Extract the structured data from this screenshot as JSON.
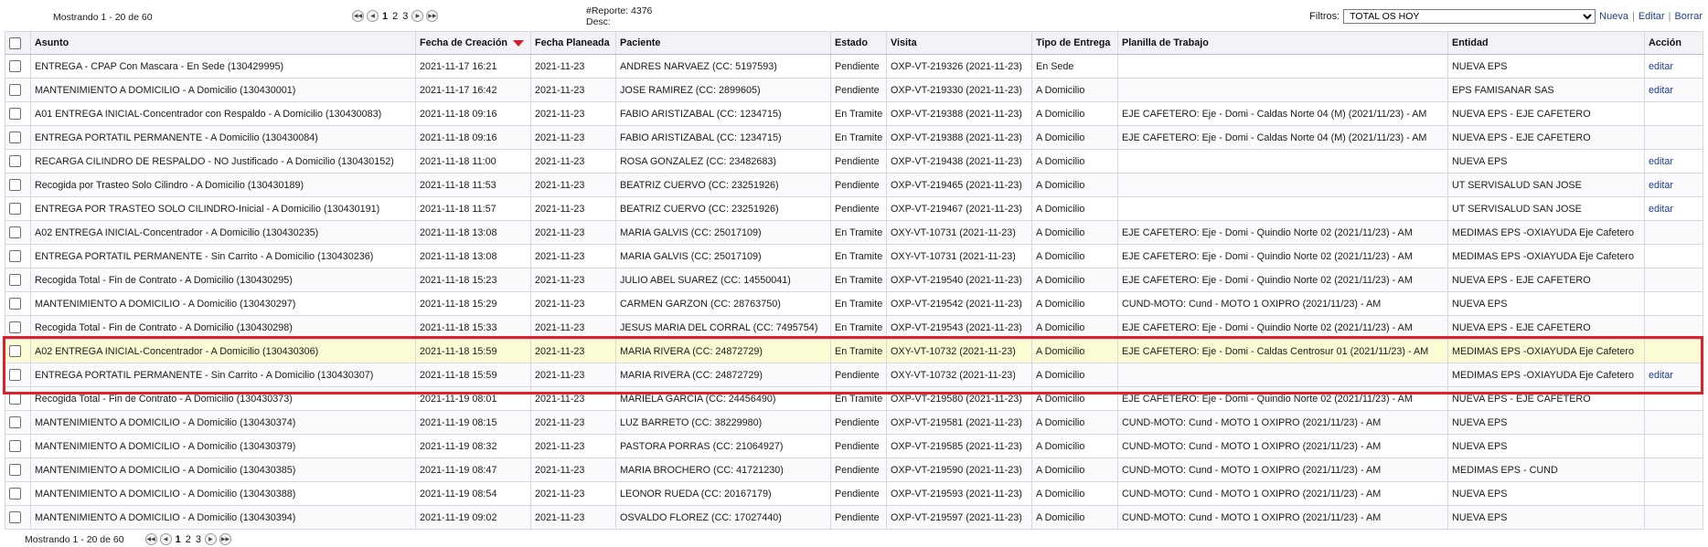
{
  "pagination": {
    "showing": "Mostrando 1 - 20 de 60",
    "pages": [
      "1",
      "2",
      "3"
    ],
    "current": "1"
  },
  "report": {
    "number": "#Reporte: 4376",
    "desc": "Desc:"
  },
  "filters": {
    "label": "Filtros:",
    "selected": "TOTAL OS HOY",
    "nueva": "Nueva",
    "editar": "Editar",
    "borrar": "Borrar"
  },
  "columns": [
    "Asunto",
    "Fecha de Creación",
    "Fecha Planeada",
    "Paciente",
    "Estado",
    "Visita",
    "Tipo de Entrega",
    "Planilla de Trabajo",
    "Entidad",
    "Acción"
  ],
  "rows": [
    {
      "asunto": "ENTREGA - CPAP Con Mascara - En Sede (130429995)",
      "creacion": "2021-11-17 16:21",
      "planeada": "2021-11-23",
      "paciente": "ANDRES NARVAEZ (CC: 5197593)",
      "estado": "Pendiente",
      "visita": "OXP-VT-219326 (2021-11-23)",
      "tipo": "En Sede",
      "planilla": "",
      "entidad": "NUEVA EPS",
      "accion": "editar"
    },
    {
      "asunto": "MANTENIMIENTO A DOMICILIO - A Domicilio (130430001)",
      "creacion": "2021-11-17 16:42",
      "planeada": "2021-11-23",
      "paciente": "JOSE RAMIREZ (CC: 2899605)",
      "estado": "Pendiente",
      "visita": "OXP-VT-219330 (2021-11-23)",
      "tipo": "A Domicilio",
      "planilla": "",
      "entidad": "EPS FAMISANAR SAS",
      "accion": "editar"
    },
    {
      "asunto": "A01 ENTREGA INICIAL-Concentrador con Respaldo - A Domicilio (130430083)",
      "creacion": "2021-11-18 09:16",
      "planeada": "2021-11-23",
      "paciente": "FABIO ARISTIZABAL (CC: 1234715)",
      "estado": "En Tramite",
      "visita": "OXP-VT-219388 (2021-11-23)",
      "tipo": "A Domicilio",
      "planilla": "EJE CAFETERO: Eje - Domi - Caldas Norte 04 (M) (2021/11/23) - AM",
      "entidad": "NUEVA EPS - EJE CAFETERO",
      "accion": ""
    },
    {
      "asunto": "ENTREGA PORTATIL PERMANENTE - A Domicilio (130430084)",
      "creacion": "2021-11-18 09:16",
      "planeada": "2021-11-23",
      "paciente": "FABIO ARISTIZABAL (CC: 1234715)",
      "estado": "En Tramite",
      "visita": "OXP-VT-219388 (2021-11-23)",
      "tipo": "A Domicilio",
      "planilla": "EJE CAFETERO: Eje - Domi - Caldas Norte 04 (M) (2021/11/23) - AM",
      "entidad": "NUEVA EPS - EJE CAFETERO",
      "accion": ""
    },
    {
      "asunto": "RECARGA CILINDRO DE RESPALDO - NO Justificado - A Domicilio (130430152)",
      "creacion": "2021-11-18 11:00",
      "planeada": "2021-11-23",
      "paciente": "ROSA GONZALEZ (CC: 23482683)",
      "estado": "Pendiente",
      "visita": "OXP-VT-219438 (2021-11-23)",
      "tipo": "A Domicilio",
      "planilla": "",
      "entidad": "NUEVA EPS",
      "accion": "editar"
    },
    {
      "asunto": "Recogida por Trasteo Solo Cilindro - A Domicilio (130430189)",
      "creacion": "2021-11-18 11:53",
      "planeada": "2021-11-23",
      "paciente": "BEATRIZ CUERVO (CC: 23251926)",
      "estado": "Pendiente",
      "visita": "OXP-VT-219465 (2021-11-23)",
      "tipo": "A Domicilio",
      "planilla": "",
      "entidad": "UT SERVISALUD SAN JOSE",
      "accion": "editar"
    },
    {
      "asunto": "ENTREGA POR TRASTEO SOLO CILINDRO-Inicial - A Domicilio (130430191)",
      "creacion": "2021-11-18 11:57",
      "planeada": "2021-11-23",
      "paciente": "BEATRIZ CUERVO (CC: 23251926)",
      "estado": "Pendiente",
      "visita": "OXP-VT-219467 (2021-11-23)",
      "tipo": "A Domicilio",
      "planilla": "",
      "entidad": "UT SERVISALUD SAN JOSE",
      "accion": "editar"
    },
    {
      "asunto": "A02 ENTREGA INICIAL-Concentrador - A Domicilio (130430235)",
      "creacion": "2021-11-18 13:08",
      "planeada": "2021-11-23",
      "paciente": "MARIA GALVIS (CC: 25017109)",
      "estado": "En Tramite",
      "visita": "OXY-VT-10731 (2021-11-23)",
      "tipo": "A Domicilio",
      "planilla": "EJE CAFETERO: Eje - Domi - Quindio Norte 02 (2021/11/23) - AM",
      "entidad": "MEDIMAS EPS -OXIAYUDA Eje Cafetero",
      "accion": ""
    },
    {
      "asunto": "ENTREGA PORTATIL PERMANENTE - Sin Carrito - A Domicilio (130430236)",
      "creacion": "2021-11-18 13:08",
      "planeada": "2021-11-23",
      "paciente": "MARIA GALVIS (CC: 25017109)",
      "estado": "En Tramite",
      "visita": "OXY-VT-10731 (2021-11-23)",
      "tipo": "A Domicilio",
      "planilla": "EJE CAFETERO: Eje - Domi - Quindio Norte 02 (2021/11/23) - AM",
      "entidad": "MEDIMAS EPS -OXIAYUDA Eje Cafetero",
      "accion": ""
    },
    {
      "asunto": "Recogida Total - Fin de Contrato - A Domicilio (130430295)",
      "creacion": "2021-11-18 15:23",
      "planeada": "2021-11-23",
      "paciente": "JULIO ABEL SUAREZ (CC: 14550041)",
      "estado": "En Tramite",
      "visita": "OXP-VT-219540 (2021-11-23)",
      "tipo": "A Domicilio",
      "planilla": "EJE CAFETERO: Eje - Domi - Quindio Norte 02 (2021/11/23) - AM",
      "entidad": "NUEVA EPS - EJE CAFETERO",
      "accion": ""
    },
    {
      "asunto": "MANTENIMIENTO A DOMICILIO - A Domicilio (130430297)",
      "creacion": "2021-11-18 15:29",
      "planeada": "2021-11-23",
      "paciente": "CARMEN GARZON (CC: 28763750)",
      "estado": "En Tramite",
      "visita": "OXP-VT-219542 (2021-11-23)",
      "tipo": "A Domicilio",
      "planilla": "CUND-MOTO: Cund - MOTO 1 OXIPRO (2021/11/23) - AM",
      "entidad": "NUEVA EPS",
      "accion": ""
    },
    {
      "asunto": "Recogida Total - Fin de Contrato - A Domicilio (130430298)",
      "creacion": "2021-11-18 15:33",
      "planeada": "2021-11-23",
      "paciente": "JESUS MARIA DEL CORRAL (CC: 7495754)",
      "estado": "En Tramite",
      "visita": "OXP-VT-219543 (2021-11-23)",
      "tipo": "A Domicilio",
      "planilla": "EJE CAFETERO: Eje - Domi - Quindio Norte 02 (2021/11/23) - AM",
      "entidad": "NUEVA EPS - EJE CAFETERO",
      "accion": ""
    },
    {
      "asunto": "A02 ENTREGA INICIAL-Concentrador - A Domicilio (130430306)",
      "creacion": "2021-11-18 15:59",
      "planeada": "2021-11-23",
      "paciente": "MARIA RIVERA (CC: 24872729)",
      "estado": "En Tramite",
      "visita": "OXY-VT-10732 (2021-11-23)",
      "tipo": "A Domicilio",
      "planilla": "EJE CAFETERO: Eje - Domi - Caldas Centrosur 01 (2021/11/23) - AM",
      "entidad": "MEDIMAS EPS -OXIAYUDA Eje Cafetero",
      "accion": "",
      "highlight": true
    },
    {
      "asunto": "ENTREGA PORTATIL PERMANENTE - Sin Carrito - A Domicilio (130430307)",
      "creacion": "2021-11-18 15:59",
      "planeada": "2021-11-23",
      "paciente": "MARIA RIVERA (CC: 24872729)",
      "estado": "Pendiente",
      "visita": "OXY-VT-10732 (2021-11-23)",
      "tipo": "A Domicilio",
      "planilla": "",
      "entidad": "MEDIMAS EPS -OXIAYUDA Eje Cafetero",
      "accion": "editar"
    },
    {
      "asunto": "Recogida Total - Fin de Contrato - A Domicilio (130430373)",
      "creacion": "2021-11-19 08:01",
      "planeada": "2021-11-23",
      "paciente": "MARIELA GARCIA (CC: 24456490)",
      "estado": "En Tramite",
      "visita": "OXP-VT-219580 (2021-11-23)",
      "tipo": "A Domicilio",
      "planilla": "EJE CAFETERO: Eje - Domi - Quindio Norte 02 (2021/11/23) - AM",
      "entidad": "NUEVA EPS - EJE CAFETERO",
      "accion": ""
    },
    {
      "asunto": "MANTENIMIENTO A DOMICILIO - A Domicilio (130430374)",
      "creacion": "2021-11-19 08:15",
      "planeada": "2021-11-23",
      "paciente": "LUZ BARRETO (CC: 38229980)",
      "estado": "Pendiente",
      "visita": "OXP-VT-219581 (2021-11-23)",
      "tipo": "A Domicilio",
      "planilla": "CUND-MOTO: Cund - MOTO 1 OXIPRO (2021/11/23) - AM",
      "entidad": "NUEVA EPS",
      "accion": ""
    },
    {
      "asunto": "MANTENIMIENTO A DOMICILIO - A Domicilio (130430379)",
      "creacion": "2021-11-19 08:32",
      "planeada": "2021-11-23",
      "paciente": "PASTORA PORRAS (CC: 21064927)",
      "estado": "Pendiente",
      "visita": "OXP-VT-219585 (2021-11-23)",
      "tipo": "A Domicilio",
      "planilla": "CUND-MOTO: Cund - MOTO 1 OXIPRO (2021/11/23) - AM",
      "entidad": "NUEVA EPS",
      "accion": ""
    },
    {
      "asunto": "MANTENIMIENTO A DOMICILIO - A Domicilio (130430385)",
      "creacion": "2021-11-19 08:47",
      "planeada": "2021-11-23",
      "paciente": "MARIA BROCHERO (CC: 41721230)",
      "estado": "Pendiente",
      "visita": "OXP-VT-219590 (2021-11-23)",
      "tipo": "A Domicilio",
      "planilla": "CUND-MOTO: Cund - MOTO 1 OXIPRO (2021/11/23) - AM",
      "entidad": "MEDIMAS EPS - CUND",
      "accion": ""
    },
    {
      "asunto": "MANTENIMIENTO A DOMICILIO - A Domicilio (130430388)",
      "creacion": "2021-11-19 08:54",
      "planeada": "2021-11-23",
      "paciente": "LEONOR RUEDA (CC: 20167179)",
      "estado": "Pendiente",
      "visita": "OXP-VT-219593 (2021-11-23)",
      "tipo": "A Domicilio",
      "planilla": "CUND-MOTO: Cund - MOTO 1 OXIPRO (2021/11/23) - AM",
      "entidad": "NUEVA EPS",
      "accion": ""
    },
    {
      "asunto": "MANTENIMIENTO A DOMICILIO - A Domicilio (130430394)",
      "creacion": "2021-11-19 09:02",
      "planeada": "2021-11-23",
      "paciente": "OSVALDO FLOREZ (CC: 17027440)",
      "estado": "Pendiente",
      "visita": "OXP-VT-219597 (2021-11-23)",
      "tipo": "A Domicilio",
      "planilla": "CUND-MOTO: Cund - MOTO 1 OXIPRO (2021/11/23) - AM",
      "entidad": "NUEVA EPS",
      "accion": ""
    }
  ],
  "icons": {
    "first": "double-left-arrow-icon",
    "prev": "left-arrow-icon",
    "next": "right-arrow-icon",
    "last": "double-right-arrow-icon",
    "sort": "sort-desc-icon"
  },
  "colors": {
    "highlight_row": "#fbfbd4",
    "annotation_box": "#e0202a",
    "sort_arrow": "#d21c2c",
    "link": "#1f3f8f"
  }
}
